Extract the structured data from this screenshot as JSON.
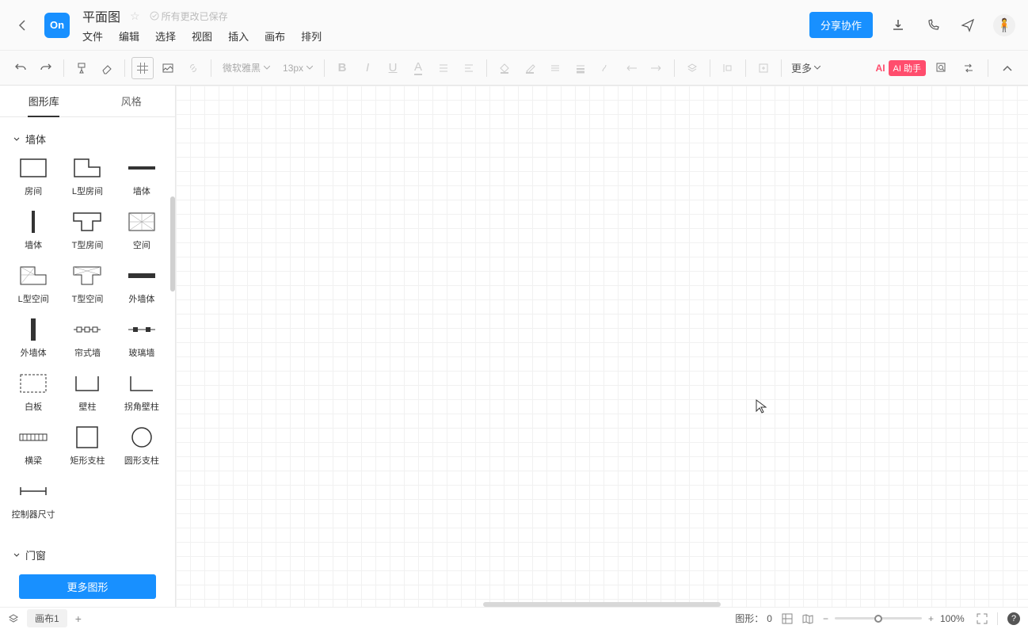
{
  "header": {
    "logo": "On",
    "title": "平面图",
    "save_status": "所有更改已保存",
    "menu": [
      "文件",
      "编辑",
      "选择",
      "视图",
      "插入",
      "画布",
      "排列"
    ],
    "share_btn": "分享协作"
  },
  "toolbar": {
    "font": "微软雅黑",
    "font_size": "13px",
    "more": "更多",
    "ai_label": "AI",
    "ai_badge": "AI 助手"
  },
  "sidebar": {
    "tabs": [
      "图形库",
      "风格"
    ],
    "cat1": "墙体",
    "cat2": "门窗",
    "shapes": [
      "房间",
      "L型房间",
      "墙体",
      "墙体",
      "T型房间",
      "空间",
      "L型空间",
      "T型空间",
      "外墙体",
      "外墙体",
      "帘式墙",
      "玻璃墙",
      "白板",
      "壁柱",
      "拐角壁柱",
      "横梁",
      "矩形支柱",
      "圆形支柱",
      "控制器尺寸"
    ],
    "more_btn": "更多图形"
  },
  "statusbar": {
    "page_tab": "画布1",
    "shape_count_label": "图形：",
    "shape_count_value": "0",
    "zoom": "100%"
  }
}
